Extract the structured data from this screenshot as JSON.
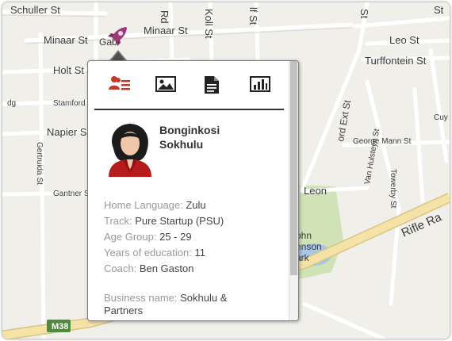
{
  "map": {
    "streets": {
      "schuller": "Schuller St",
      "minaar_left": "Minaar St",
      "minaar_right": "Minaar St",
      "holt": "Holt St",
      "rd": "Rd",
      "koll": "Koll St",
      "lf": "lf St",
      "st_top_right": "St",
      "st_right_edge": "St",
      "leo": "Leo St",
      "turffontein": "Turffontein St",
      "dg": "dg",
      "stamford": "Stamford",
      "napier": "Napier St",
      "gertruida": "Gertruida St",
      "gantner": "Gantner St",
      "george_mann": "George Mann St",
      "towerby": "Towerby St",
      "van_hulsteyn": "Van Hulsteyn St",
      "cuy": "Cuy",
      "ord_ext": "ord Ext St",
      "leon": "Leon",
      "rifle": "Rifle Ra",
      "park_a": "ohn",
      "park_b": "enson",
      "park_c": "ark",
      "m38": "M38",
      "gab": "Gab"
    }
  },
  "popup": {
    "tabs": [
      "profile-icon",
      "image-icon",
      "document-icon",
      "bar-chart-icon"
    ],
    "name_line1": "Bonginkosi",
    "name_line2": "Sokhulu",
    "fields": [
      {
        "label": "Home Language:",
        "value": " Zulu"
      },
      {
        "label": "Track:",
        "value": " Pure Startup (PSU)"
      },
      {
        "label": "Age Group:",
        "value": " 25 - 29"
      },
      {
        "label": "Years of education:",
        "value": " 11"
      },
      {
        "label": "Coach:",
        "value": " Ben Gaston"
      }
    ],
    "business": {
      "label": "Business name:",
      "value_line1": " Sokhulu &",
      "value_line2": "Partners"
    }
  },
  "colors": {
    "pin": "#9c3b78",
    "tab_active": "#c0392b",
    "road": "#f4e2a6",
    "park": "#cfe3b6",
    "water": "#a9c6e6"
  }
}
